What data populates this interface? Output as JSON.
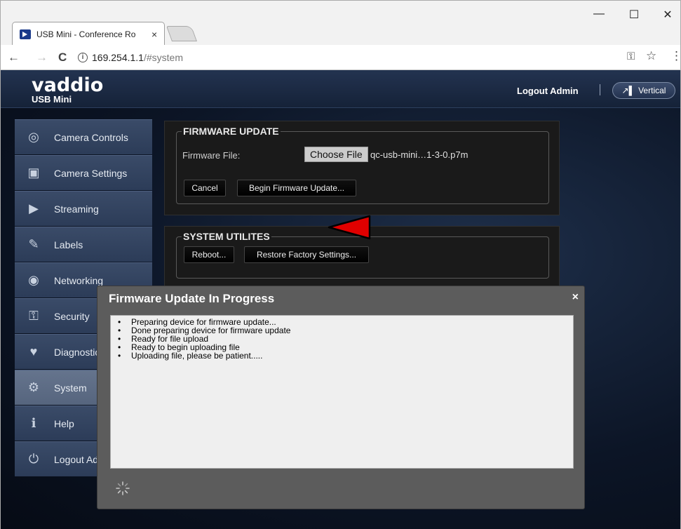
{
  "browser": {
    "tab_title": "USB Mini - Conference Ro",
    "tab_close": "×",
    "url_host": "169.254.1.1",
    "url_path": "/#system",
    "back": "←",
    "forward": "→",
    "reload": "C",
    "key_icon": "⚿",
    "star_icon": "☆",
    "menu_icon": "⋮",
    "minimize": "—",
    "maximize": "☐",
    "close": "✕"
  },
  "header": {
    "logo": "vaddio",
    "product": "USB Mini",
    "logout": "Logout Admin",
    "vertical": "Vertical"
  },
  "sidebar": {
    "items": [
      {
        "label": "Camera Controls",
        "icon": "camera-controls-icon",
        "glyph": "◎"
      },
      {
        "label": "Camera Settings",
        "icon": "camera-settings-icon",
        "glyph": "▣"
      },
      {
        "label": "Streaming",
        "icon": "streaming-icon",
        "glyph": "▶"
      },
      {
        "label": "Labels",
        "icon": "labels-icon",
        "glyph": "✎"
      },
      {
        "label": "Networking",
        "icon": "networking-icon",
        "glyph": "◉"
      },
      {
        "label": "Security",
        "icon": "security-icon",
        "glyph": "⚿"
      },
      {
        "label": "Diagnostics",
        "icon": "diagnostics-icon",
        "glyph": "♥"
      },
      {
        "label": "System",
        "icon": "system-gear-icon",
        "glyph": "⚙"
      },
      {
        "label": "Help",
        "icon": "help-icon",
        "glyph": "ℹ"
      },
      {
        "label": "Logout Admin",
        "icon": "logout-icon",
        "glyph": "⏻"
      }
    ]
  },
  "firmware": {
    "legend": "FIRMWARE UPDATE",
    "file_label": "Firmware File:",
    "choose_label": "Choose File",
    "file_name": "qc-usb-mini…1-3-0.p7m",
    "cancel": "Cancel",
    "begin": "Begin Firmware Update..."
  },
  "utilities": {
    "legend": "SYSTEM UTILITES",
    "reboot": "Reboot...",
    "restore": "Restore Factory Settings..."
  },
  "modal": {
    "title": "Firmware Update In Progress",
    "close": "×",
    "log": [
      "Preparing device for firmware update...",
      "Done preparing device for firmware update",
      "Ready for file upload",
      "Ready to begin uploading file",
      "Uploading file, please be patient....."
    ]
  },
  "colors": {
    "page_bg": "#0c1526",
    "sidebar_item": "#34445f",
    "sidebar_active": "#5e6d86",
    "modal_bg": "#5c5c5c",
    "annotation_arrow": "#e00000"
  }
}
